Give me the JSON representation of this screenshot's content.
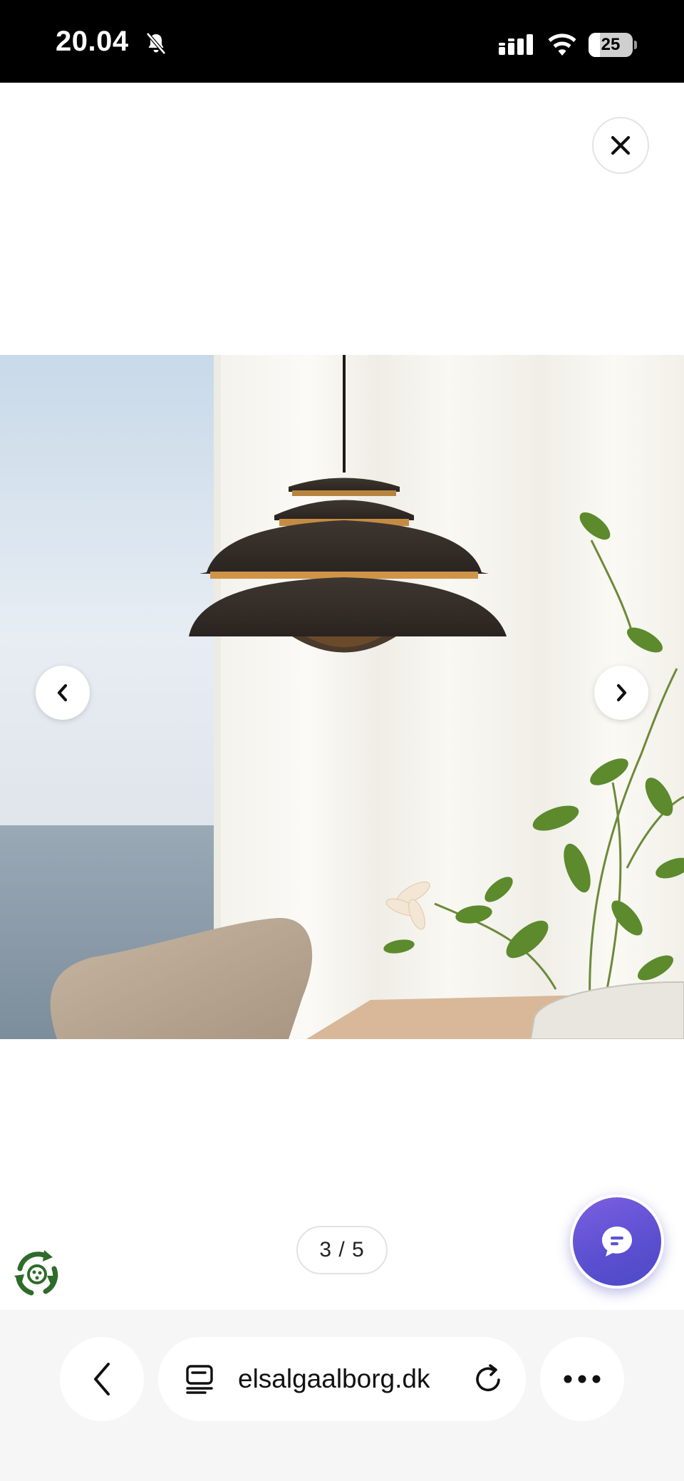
{
  "status_bar": {
    "time": "20.04",
    "battery_level": "25",
    "icons": [
      "bell-muted-icon",
      "cellular-signal-icon",
      "wifi-icon",
      "battery-icon"
    ]
  },
  "gallery": {
    "counter": "3 / 5",
    "current_index": 3,
    "total": 5,
    "icons": [
      "close-icon",
      "chevron-left-icon",
      "chevron-right-icon"
    ]
  },
  "widgets": {
    "chat_icon": "chat-bubble-icon",
    "recycle_icon": "recycle-icon",
    "chat_color": "#6a56d8"
  },
  "browser": {
    "url": "elsalgaalborg.dk",
    "icons": [
      "back-arrow-icon",
      "reader-icon",
      "reload-icon",
      "more-icon"
    ]
  }
}
